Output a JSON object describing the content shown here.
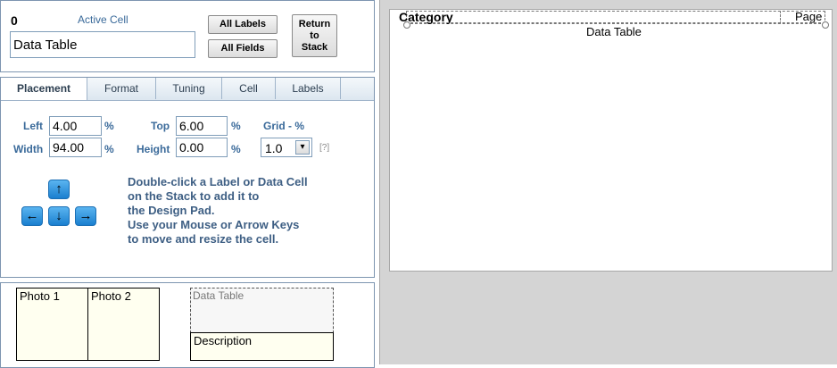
{
  "active_cell": {
    "index": "0",
    "label": "Active Cell",
    "name_value": "Data Table"
  },
  "buttons": {
    "all_labels": "All Labels",
    "all_fields": "All Fields",
    "return_line1": "Return",
    "return_line2": "to",
    "return_line3": "Stack"
  },
  "tabs": [
    "Placement",
    "Format",
    "Tuning",
    "Cell",
    "Labels"
  ],
  "placement": {
    "left_label": "Left",
    "left_value": "4.00",
    "top_label": "Top",
    "top_value": "6.00",
    "width_label": "Width",
    "width_value": "94.00",
    "height_label": "Height",
    "height_value": "0.00",
    "unit": "%",
    "grid_label": "Grid - %",
    "grid_value": "1.0",
    "help": "[?]"
  },
  "arrows": {
    "up": "↑",
    "left": "←",
    "down": "↓",
    "right": "→"
  },
  "instructions": [
    "Double-click a Label or Data Cell",
    "on the Stack to add it to",
    "the Design Pad.",
    "Use your Mouse or Arrow Keys",
    "to move and resize the cell."
  ],
  "thumbnails": {
    "photo1": "Photo 1",
    "photo2": "Photo 2",
    "data_table": "Data Table",
    "description": "Description"
  },
  "design_pad": {
    "category": "Category",
    "page": "Page",
    "data_table": "Data Table"
  },
  "colors": {
    "panel_border": "#7d95b0",
    "label_blue": "#3a6a9a",
    "arrow_blue": "#1a7fcf",
    "cell_bg": "#fffff0",
    "workspace_gray": "#d4d4d4"
  }
}
